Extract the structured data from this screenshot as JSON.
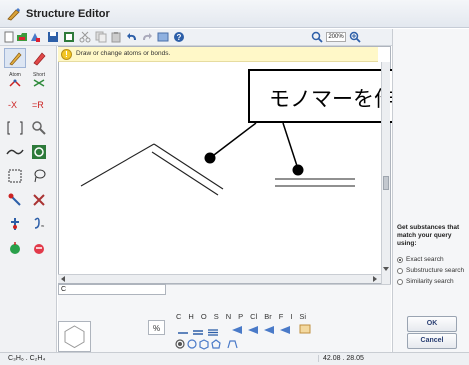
{
  "window": {
    "title": "Structure Editor"
  },
  "toolbar": {
    "zoom": "200%"
  },
  "hint": {
    "text": "Draw or change atoms or bonds."
  },
  "left_tools": {
    "atom_label": "Atom",
    "short_label": "Short"
  },
  "callout": {
    "text": "モノマーを作図"
  },
  "query_panel": {
    "heading": "Get substances that match your query using:",
    "options": [
      {
        "label": "Exact search",
        "selected": true
      },
      {
        "label": "Substructure search",
        "selected": false
      },
      {
        "label": "Similarity search",
        "selected": false
      }
    ],
    "ok_label": "OK",
    "cancel_label": "Cancel"
  },
  "bottom": {
    "formula_value": "C",
    "elements": [
      "C",
      "H",
      "O",
      "S",
      "N",
      "P",
      "Cl",
      "Br",
      "F",
      "I",
      "Si"
    ]
  },
  "status": {
    "formula": "C₃H₆ . C₂H₄",
    "coords": "42.08 . 28.05"
  },
  "colors": {
    "accent": "#3a6fb0",
    "hint_bg": "#fff8c8",
    "callout_border": "#000000"
  }
}
